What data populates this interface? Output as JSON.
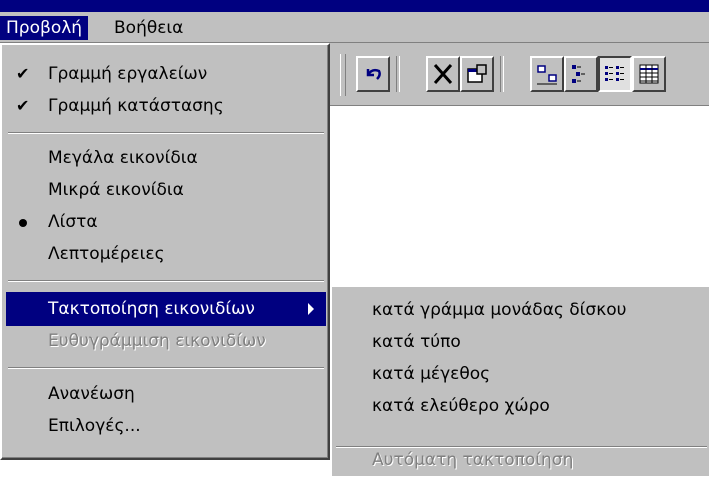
{
  "menubar": {
    "view": "Προβολή",
    "help": "Βοήθεια"
  },
  "view_menu": {
    "items": [
      {
        "label": "Γραμμή εργαλείων",
        "state": "checked"
      },
      {
        "label": "Γραμμή κατάστασης",
        "state": "checked"
      },
      {
        "label": "Μεγάλα εικονίδια",
        "state": "none"
      },
      {
        "label": "Μικρά εικονίδια",
        "state": "none"
      },
      {
        "label": "Λίστα",
        "state": "selected"
      },
      {
        "label": "Λεπτομέρειες",
        "state": "none"
      },
      {
        "label": "Τακτοποίηση εικονιδίων",
        "state": "highlighted-submenu"
      },
      {
        "label": "Ευθυγράμμιση εικονιδίων",
        "state": "disabled"
      },
      {
        "label": "Ανανέωση",
        "state": "none"
      },
      {
        "label": "Επιλογές...",
        "state": "none"
      }
    ]
  },
  "submenu": {
    "items": [
      {
        "label": "κατά γράμμα μονάδας δίσκου"
      },
      {
        "label": "κατά τύπο"
      },
      {
        "label": "κατά μέγεθος"
      },
      {
        "label": "κατά ελεύθερο χώρο"
      },
      {
        "label": "Αυτόματη τακτοποίηση",
        "state": "disabled"
      }
    ]
  },
  "toolbar": {
    "buttons": [
      "undo-icon",
      "delete-icon",
      "properties-icon",
      "large-icons-icon",
      "small-icons-icon",
      "list-icon",
      "details-icon"
    ]
  },
  "colors": {
    "menu_bg": "#c0c0c0",
    "highlight": "#000080",
    "disabled_text": "#808080"
  }
}
